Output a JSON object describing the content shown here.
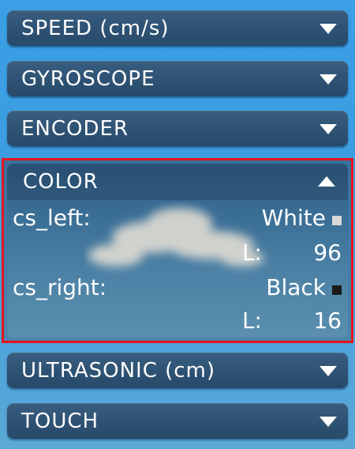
{
  "panels": {
    "speed": {
      "label": "SPEED (cm/s)"
    },
    "gyroscope": {
      "label": "GYROSCOPE"
    },
    "encoder": {
      "label": "ENCODER"
    },
    "color": {
      "label": "COLOR",
      "left": {
        "name": "cs_left:",
        "color_name": "White",
        "l_label": "L:",
        "l_value": "96",
        "swatch_color": "#d9d9d9"
      },
      "right": {
        "name": "cs_right:",
        "color_name": "Black",
        "l_label": "L:",
        "l_value": "16",
        "swatch_color": "#1a1a1a"
      }
    },
    "ultrasonic": {
      "label": "ULTRASONIC (cm)"
    },
    "touch": {
      "label": "TOUCH"
    }
  },
  "colors": {
    "highlight_border": "#e8141c",
    "panel_bg": "#2e5273",
    "background": "#3d9de0"
  },
  "icons": {
    "collapsed": "triangle-down-icon",
    "expanded": "triangle-up-icon"
  }
}
